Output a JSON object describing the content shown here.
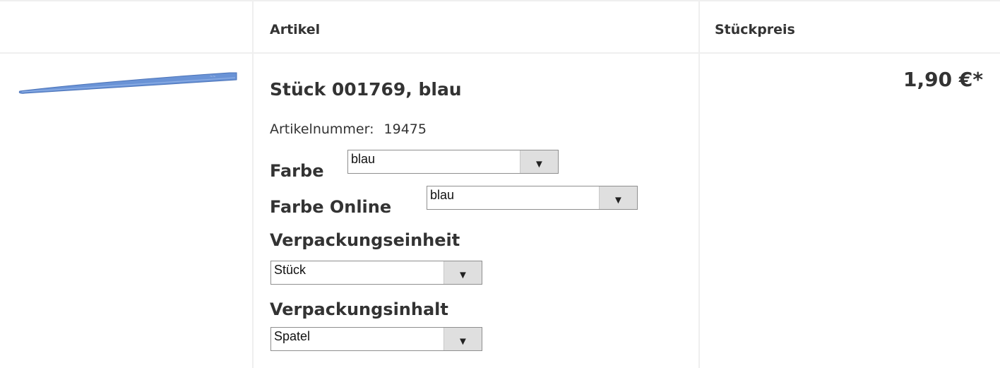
{
  "header": {
    "article_col": "Artikel",
    "price_col": "Stückpreis"
  },
  "product": {
    "title": "Stück 001769, blau",
    "article_number_label": "Artikelnummer:",
    "article_number": "19475",
    "price": "1,90 €*",
    "image": "blue-spatula-image",
    "image_color": "#5a86cf"
  },
  "options": {
    "farbe": {
      "label": "Farbe",
      "value": "blau"
    },
    "farbe_online": {
      "label": "Farbe Online",
      "value": "blau"
    },
    "verpackungseinheit": {
      "label": "Verpackungseinheit",
      "value": "Stück"
    },
    "verpackungsinhalt": {
      "label": "Verpackungsinhalt",
      "value": "Spatel"
    }
  }
}
